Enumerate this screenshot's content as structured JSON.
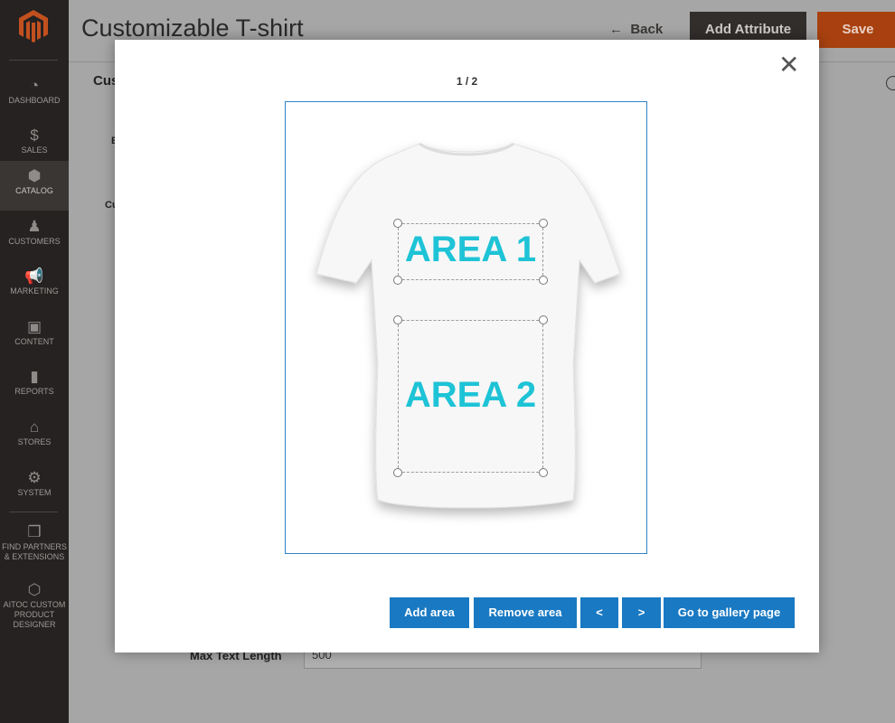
{
  "sidebar": {
    "items": [
      {
        "label": "DASHBOARD",
        "icon": "gauge-icon"
      },
      {
        "label": "SALES",
        "icon": "dollar-icon"
      },
      {
        "label": "CATALOG",
        "icon": "box-icon",
        "active": true
      },
      {
        "label": "CUSTOMERS",
        "icon": "person-icon"
      },
      {
        "label": "MARKETING",
        "icon": "megaphone-icon"
      },
      {
        "label": "CONTENT",
        "icon": "layout-icon"
      },
      {
        "label": "REPORTS",
        "icon": "bar-chart-icon"
      },
      {
        "label": "STORES",
        "icon": "storefront-icon"
      },
      {
        "label": "SYSTEM",
        "icon": "gear-icon"
      },
      {
        "label": "FIND PARTNERS & EXTENSIONS",
        "icon": "cubes-icon"
      },
      {
        "label": "AITOC CUSTOM PRODUCT DESIGNER",
        "icon": "hexagon-icon"
      }
    ]
  },
  "header": {
    "title": "Customizable T-shirt",
    "back": "Back",
    "add_attribute": "Add Attribute",
    "save": "Save"
  },
  "background": {
    "section": "Cus",
    "label_e": "E",
    "label_cu": "Cu",
    "max_text_label": "Max Text Length",
    "max_text_value": "500"
  },
  "modal": {
    "pager": "1 / 2",
    "areas": [
      "AREA 1",
      "AREA 2"
    ],
    "buttons": {
      "add": "Add area",
      "remove": "Remove area",
      "prev": "<",
      "next": ">",
      "gallery": "Go to gallery page"
    }
  },
  "colors": {
    "accent": "#1979c3",
    "area_text": "#1ec3d6",
    "save": "#eb5202"
  }
}
